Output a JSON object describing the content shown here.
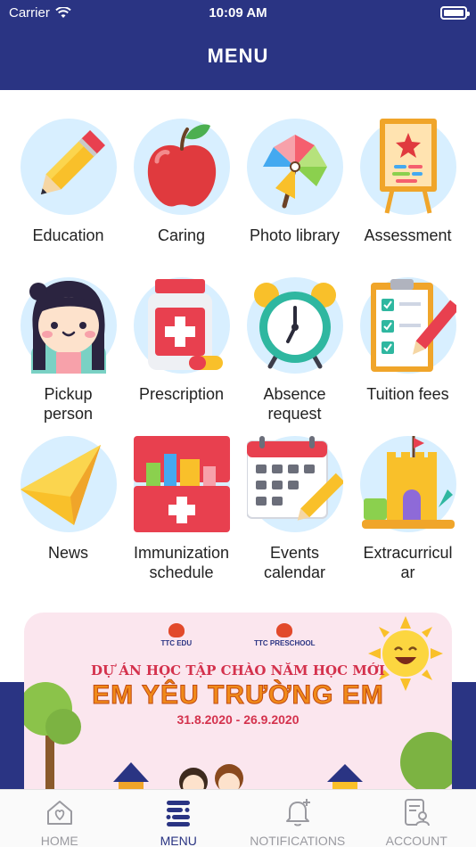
{
  "status": {
    "carrier": "Carrier",
    "time": "10:09 AM"
  },
  "header": {
    "title": "MENU"
  },
  "menu": [
    {
      "label": "Education",
      "icon": "pencil-icon"
    },
    {
      "label": "Caring",
      "icon": "apple-icon"
    },
    {
      "label": "Photo library",
      "icon": "pinwheel-icon"
    },
    {
      "label": "Assessment",
      "icon": "easel-icon"
    },
    {
      "label": "Pickup\nperson",
      "icon": "girl-avatar-icon"
    },
    {
      "label": "Prescription",
      "icon": "medicine-bottle-icon"
    },
    {
      "label": "Absence\nrequest",
      "icon": "alarm-clock-icon"
    },
    {
      "label": "Tuition fees",
      "icon": "checklist-icon"
    },
    {
      "label": "News",
      "icon": "paper-plane-icon"
    },
    {
      "label": "Immunization\nschedule",
      "icon": "first-aid-kit-icon"
    },
    {
      "label": "Events\ncalendar",
      "icon": "calendar-icon"
    },
    {
      "label": "Extracurricul\nar",
      "icon": "sandcastle-icon"
    }
  ],
  "banner": {
    "logo1": "TTC EDU",
    "logo2": "TTC PRESCHOOL",
    "project": "DỰ ÁN HỌC TẬP CHÀO NĂM HỌC MỚI",
    "slogan": "EM YÊU TRƯỜNG EM",
    "dates": "31.8.2020 - 26.9.2020"
  },
  "tabs": [
    {
      "label": "HOME",
      "icon": "home-icon",
      "active": false
    },
    {
      "label": "MENU",
      "icon": "menu-icon",
      "active": true
    },
    {
      "label": "NOTIFICATIONS",
      "icon": "bell-icon",
      "active": false
    },
    {
      "label": "ACCOUNT",
      "icon": "account-icon",
      "active": false
    }
  ],
  "colors": {
    "primary": "#2a3483",
    "tile_bg": "#d8efff",
    "tab_inactive": "#9a9aa0"
  }
}
